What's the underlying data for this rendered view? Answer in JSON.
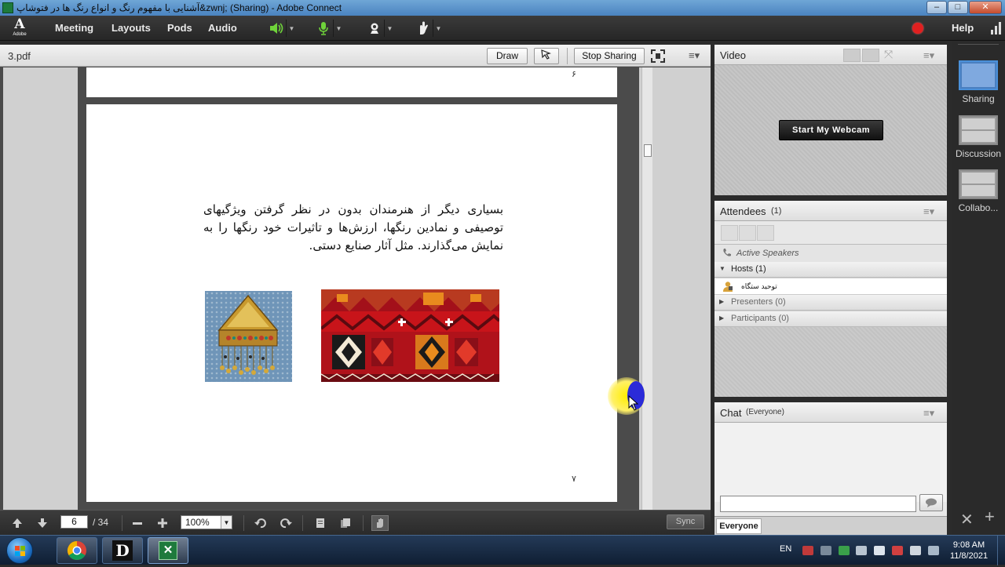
{
  "window": {
    "title": "آشنایی با مفهوم رنگ و انواع رنگ ها در فتوشاپ&zwnj; (Sharing) - Adobe Connect",
    "minimize": "–",
    "maximize": "□",
    "close": "✕"
  },
  "menubar": {
    "logo_text": "Adobe",
    "items": [
      "Meeting",
      "Layouts",
      "Pods",
      "Audio"
    ],
    "speaker_icon": "speaker-icon",
    "mic_icon": "microphone-icon",
    "webcam_icon": "webcam-icon",
    "status_icon": "raise-hand-icon",
    "recording_color": "#e02020",
    "help": "Help"
  },
  "share_pod": {
    "doc_name": "3.pdf",
    "draw_label": "Draw",
    "stop_sharing_label": "Stop Sharing",
    "page_number_top": "۶",
    "page_number_bottom": "۷",
    "body_text": "بسیاری دیگر از هنرمندان بدون در نظر گرفتن ویژگیهای توصیفی و نمادین رنگها، ارزش‌ها و تاثیرات خود رنگها را به نمایش می‌گذارند. مثل آثار صنایع دستی.",
    "footer": {
      "current_page": "6",
      "total_pages": "/ 34",
      "zoom": "100%",
      "sync_label": "Sync"
    }
  },
  "video_pod": {
    "title": "Video",
    "start_webcam": "Start My Webcam"
  },
  "attendees_pod": {
    "title": "Attendees",
    "count": "(1)",
    "active_speakers": "Active Speakers",
    "hosts": "Hosts (1)",
    "host_user": "توحید ستگاه",
    "presenters": "Presenters (0)",
    "participants": "Participants (0)"
  },
  "chat_pod": {
    "title": "Chat",
    "scope": "(Everyone)",
    "tab": "Everyone"
  },
  "layouts": [
    "Sharing",
    "Discussion",
    "Collabo..."
  ],
  "taskbar": {
    "lang": "EN",
    "time": "9:08 AM",
    "date": "11/8/2021"
  }
}
